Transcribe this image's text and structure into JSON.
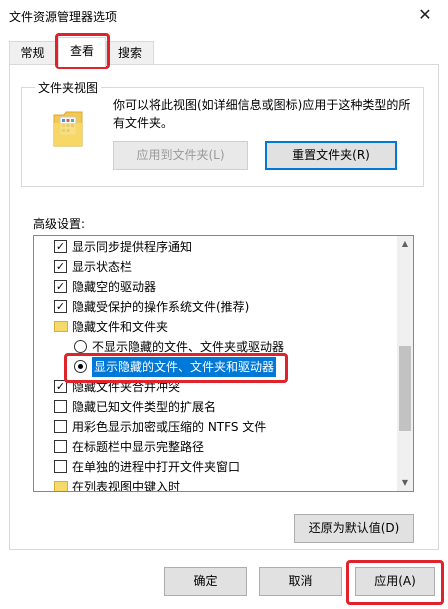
{
  "window": {
    "title": "文件资源管理器选项",
    "close_glyph": "✕"
  },
  "tabs": [
    {
      "label": "常规"
    },
    {
      "label": "查看"
    },
    {
      "label": "搜索"
    }
  ],
  "folder_views": {
    "title": "文件夹视图",
    "description": "你可以将此视图(如详细信息或图标)应用于这种类型的所有文件夹。",
    "apply_button": "应用到文件夹(L)",
    "reset_button": "重置文件夹(R)"
  },
  "advanced": {
    "label": "高级设置:",
    "items": [
      {
        "kind": "checkbox",
        "checked": true,
        "label": "显示同步提供程序通知"
      },
      {
        "kind": "checkbox",
        "checked": true,
        "label": "显示状态栏"
      },
      {
        "kind": "checkbox",
        "checked": true,
        "label": "隐藏空的驱动器"
      },
      {
        "kind": "checkbox",
        "checked": true,
        "label": "隐藏受保护的操作系统文件(推荐)"
      },
      {
        "kind": "folder",
        "label": "隐藏文件和文件夹"
      },
      {
        "kind": "radio",
        "checked": false,
        "label": "不显示隐藏的文件、文件夹或驱动器"
      },
      {
        "kind": "radio",
        "checked": true,
        "label": "显示隐藏的文件、文件夹和驱动器"
      },
      {
        "kind": "checkbox",
        "checked": true,
        "label": "隐藏文件夹合并冲突"
      },
      {
        "kind": "checkbox",
        "checked": false,
        "label": "隐藏已知文件类型的扩展名"
      },
      {
        "kind": "checkbox",
        "checked": false,
        "label": "用彩色显示加密或压缩的 NTFS 文件"
      },
      {
        "kind": "checkbox",
        "checked": false,
        "label": "在标题栏中显示完整路径"
      },
      {
        "kind": "checkbox",
        "checked": false,
        "label": "在单独的进程中打开文件夹窗口"
      },
      {
        "kind": "folder",
        "label": "在列表视图中键入时"
      }
    ],
    "restore_button": "还原为默认值(D)"
  },
  "footer": {
    "ok_button": "确定",
    "cancel_button": "取消",
    "apply_button": "应用(A)"
  },
  "check_glyph": "✓",
  "scroll_up_glyph": "▲",
  "scroll_down_glyph": "▼",
  "colors": {
    "highlight_box": "#e0232a",
    "selection": "#0078d7",
    "folder_icon": "#f7d96b"
  }
}
